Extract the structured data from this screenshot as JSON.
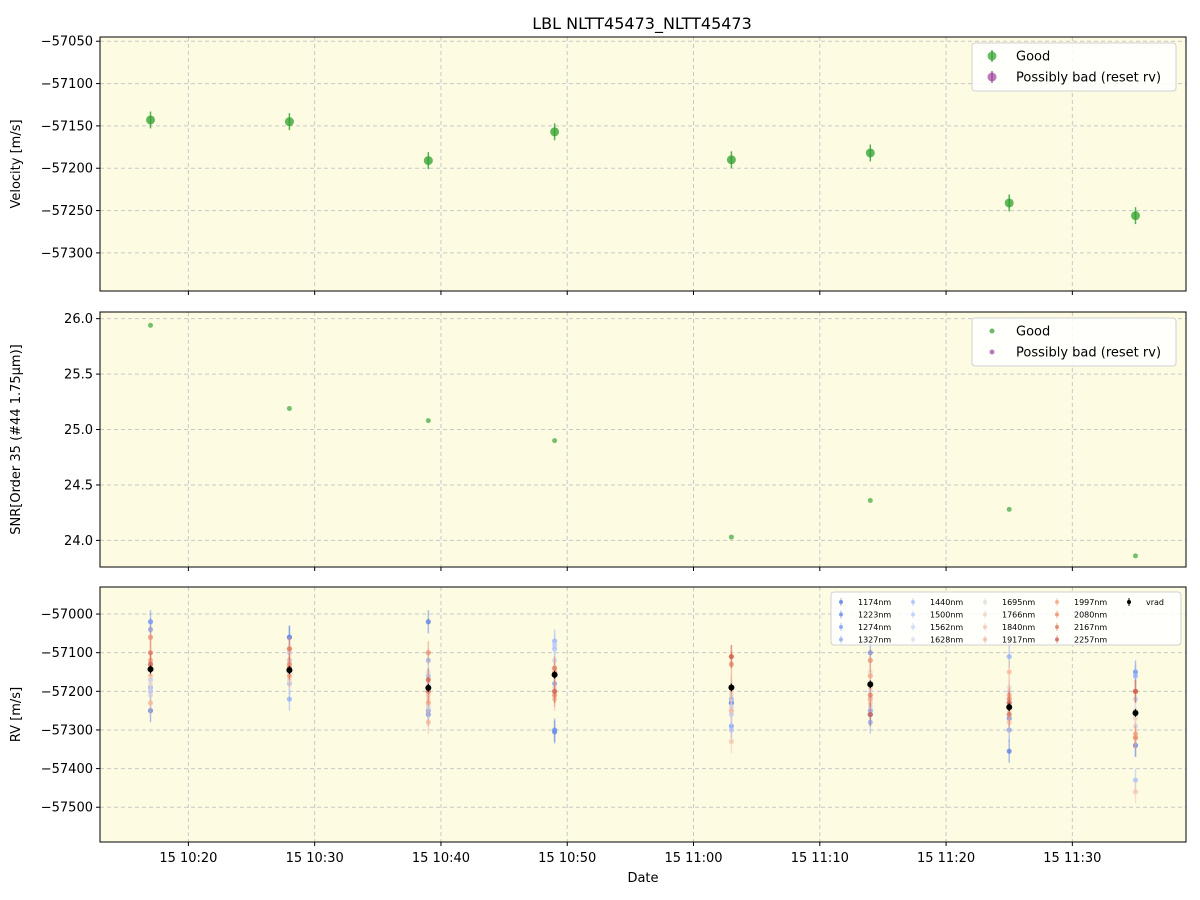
{
  "figure": {
    "title": "LBL NLTT45473_NLTT45473"
  },
  "colors": {
    "panel_bg": "#fdfce3",
    "good": "#2ca02c",
    "bad": "#a040a0",
    "vrad": "#000000",
    "grid": "#c8c8c8"
  },
  "chart_data": [
    {
      "type": "scatter",
      "panel": "velocity",
      "title": "LBL NLTT45473_NLTT45473",
      "xlabel": "",
      "ylabel": "Velocity [m/s]",
      "x": [
        "15 10:17",
        "15 10:28",
        "15 10:39",
        "15 10:49",
        "15 11:03",
        "15 11:14",
        "15 11:25",
        "15 11:35"
      ],
      "series": [
        {
          "name": "Good",
          "values": [
            -57143,
            -57145,
            -57191,
            -57157,
            -57190,
            -57182,
            -57241,
            -57256
          ],
          "errors": [
            10,
            10,
            10,
            10,
            10,
            10,
            10,
            10
          ]
        },
        {
          "name": "Possibly bad (reset rv)",
          "values": []
        }
      ],
      "ylim": [
        -57345,
        -57045
      ],
      "yticks": [
        -57300,
        -57250,
        -57200,
        -57150,
        -57100,
        -57050
      ],
      "ytick_labels": [
        "−57300",
        "−57250",
        "−57200",
        "−57150",
        "−57100",
        "−57050"
      ],
      "legend": "upper right",
      "grid": true
    },
    {
      "type": "scatter",
      "panel": "snr",
      "xlabel": "",
      "ylabel": "SNR[Order 35 (#44 1.75μm)]",
      "x": [
        "15 10:17",
        "15 10:28",
        "15 10:39",
        "15 10:49",
        "15 11:03",
        "15 11:14",
        "15 11:25",
        "15 11:35"
      ],
      "series": [
        {
          "name": "Good",
          "values": [
            25.94,
            25.19,
            25.08,
            24.9,
            24.03,
            24.36,
            24.28,
            23.86
          ]
        },
        {
          "name": "Possibly bad (reset rv)",
          "values": []
        }
      ],
      "ylim": [
        23.76,
        26.06
      ],
      "yticks": [
        24.0,
        24.5,
        25.0,
        25.5,
        26.0
      ],
      "ytick_labels": [
        "24.0",
        "24.5",
        "25.0",
        "25.5",
        "26.0"
      ],
      "legend": "upper right",
      "grid": true
    },
    {
      "type": "scatter",
      "panel": "rv",
      "xlabel": "Date",
      "ylabel": "RV [m/s]",
      "x": [
        "15 10:17",
        "15 10:28",
        "15 10:39",
        "15 10:49",
        "15 11:03",
        "15 11:14",
        "15 11:25",
        "15 11:35"
      ],
      "xticks": [
        "15 10:20",
        "15 10:30",
        "15 10:40",
        "15 10:50",
        "15 11:00",
        "15 11:10",
        "15 11:20",
        "15 11:30"
      ],
      "series": [
        {
          "name": "1174nm",
          "color": "#5b7fe3",
          "values": [
            -57250,
            -57060,
            -57020,
            -57305,
            -57230,
            -57260,
            -57355,
            -57340
          ],
          "errors": [
            30,
            30,
            30,
            30,
            30,
            30,
            30,
            30
          ]
        },
        {
          "name": "1223nm",
          "color": "#6a8ef0",
          "values": [
            -57020,
            -57060,
            -57260,
            -57300,
            -57230,
            -57100,
            -57270,
            -57150
          ],
          "errors": [
            30,
            30,
            30,
            30,
            30,
            30,
            30,
            30
          ]
        },
        {
          "name": "1274nm",
          "color": "#7d9ef6",
          "values": [
            -57040,
            -57120,
            -57250,
            -57180,
            -57290,
            -57250,
            -57300,
            -57340
          ],
          "errors": [
            30,
            30,
            30,
            30,
            30,
            30,
            30,
            30
          ]
        },
        {
          "name": "1327nm",
          "color": "#90aefa",
          "values": [
            -57190,
            -57220,
            -57120,
            -57070,
            -57220,
            -57280,
            -57110,
            -57160
          ],
          "errors": [
            30,
            30,
            30,
            30,
            30,
            30,
            30,
            30
          ]
        },
        {
          "name": "1440nm",
          "color": "#a5befc",
          "values": [
            -57200,
            -57180,
            -57160,
            -57090,
            -57300,
            -57180,
            -57230,
            -57430
          ],
          "errors": [
            30,
            30,
            30,
            30,
            30,
            30,
            30,
            30
          ]
        },
        {
          "name": "1500nm",
          "color": "#b8cbfb",
          "values": [
            -57170,
            -57100,
            -57200,
            -57080,
            -57260,
            -57220,
            -57260,
            -57220
          ],
          "errors": [
            30,
            30,
            30,
            30,
            30,
            30,
            30,
            30
          ]
        },
        {
          "name": "1562nm",
          "color": "#c9d6f6",
          "values": [
            -57210,
            -57150,
            -57240,
            -57120,
            -57240,
            -57240,
            -57200,
            -57290
          ],
          "errors": [
            30,
            30,
            30,
            30,
            30,
            30,
            30,
            30
          ]
        },
        {
          "name": "1628nm",
          "color": "#d8def0",
          "values": [
            -57130,
            -57130,
            -57180,
            -57160,
            -57250,
            -57200,
            -57220,
            -57200
          ],
          "errors": [
            30,
            30,
            30,
            30,
            30,
            30,
            30,
            30
          ]
        },
        {
          "name": "1695nm",
          "color": "#e6dcd6",
          "values": [
            -57180,
            -57170,
            -57150,
            -57190,
            -57210,
            -57150,
            -57190,
            -57250
          ],
          "errors": [
            30,
            30,
            30,
            30,
            30,
            30,
            30,
            30
          ]
        },
        {
          "name": "1766nm",
          "color": "#efd3c6",
          "values": [
            -57140,
            -57120,
            -57220,
            -57140,
            -57200,
            -57190,
            -57250,
            -57270
          ],
          "errors": [
            30,
            30,
            30,
            30,
            30,
            30,
            30,
            30
          ]
        },
        {
          "name": "1840nm",
          "color": "#f4c6b0",
          "values": [
            -57160,
            -57140,
            -57210,
            -57200,
            -57330,
            -57230,
            -57280,
            -57460
          ],
          "errors": [
            30,
            30,
            30,
            30,
            30,
            30,
            30,
            30
          ]
        },
        {
          "name": "1917nm",
          "color": "#f5b69a",
          "values": [
            -57230,
            -57090,
            -57280,
            -57220,
            -57250,
            -57220,
            -57150,
            -57320
          ],
          "errors": [
            30,
            30,
            30,
            30,
            30,
            30,
            30,
            30
          ]
        },
        {
          "name": "1997nm",
          "color": "#f2a382",
          "values": [
            -57120,
            -57160,
            -57230,
            -57150,
            -57110,
            -57160,
            -57210,
            -57310
          ],
          "errors": [
            30,
            30,
            30,
            30,
            30,
            30,
            30,
            30
          ]
        },
        {
          "name": "2080nm",
          "color": "#ec8e6c",
          "values": [
            -57060,
            -57130,
            -57100,
            -57210,
            -57130,
            -57120,
            -57220,
            -57320
          ],
          "errors": [
            30,
            30,
            30,
            30,
            30,
            30,
            30,
            30
          ]
        },
        {
          "name": "2167nm",
          "color": "#e07a5c",
          "values": [
            -57100,
            -57090,
            -57200,
            -57140,
            -57190,
            -57210,
            -57260,
            -57200
          ],
          "errors": [
            30,
            30,
            30,
            30,
            30,
            30,
            30,
            30
          ]
        },
        {
          "name": "2257nm",
          "color": "#d0604f",
          "values": [
            -57130,
            -57140,
            -57170,
            -57200,
            -57110,
            -57260,
            -57230,
            -57200
          ],
          "errors": [
            30,
            30,
            30,
            30,
            30,
            30,
            30,
            30
          ]
        },
        {
          "name": "vrad",
          "color": "#000000",
          "values": [
            -57143,
            -57145,
            -57191,
            -57157,
            -57190,
            -57182,
            -57241,
            -57256
          ],
          "errors": [
            10,
            10,
            10,
            10,
            10,
            10,
            10,
            10
          ]
        }
      ],
      "ylim": [
        -57590,
        -56930
      ],
      "yticks": [
        -57500,
        -57400,
        -57300,
        -57200,
        -57100,
        -57000
      ],
      "ytick_labels": [
        "−57500",
        "−57400",
        "−57300",
        "−57200",
        "−57100",
        "−57000"
      ],
      "legend": "upper right",
      "grid": true
    }
  ]
}
